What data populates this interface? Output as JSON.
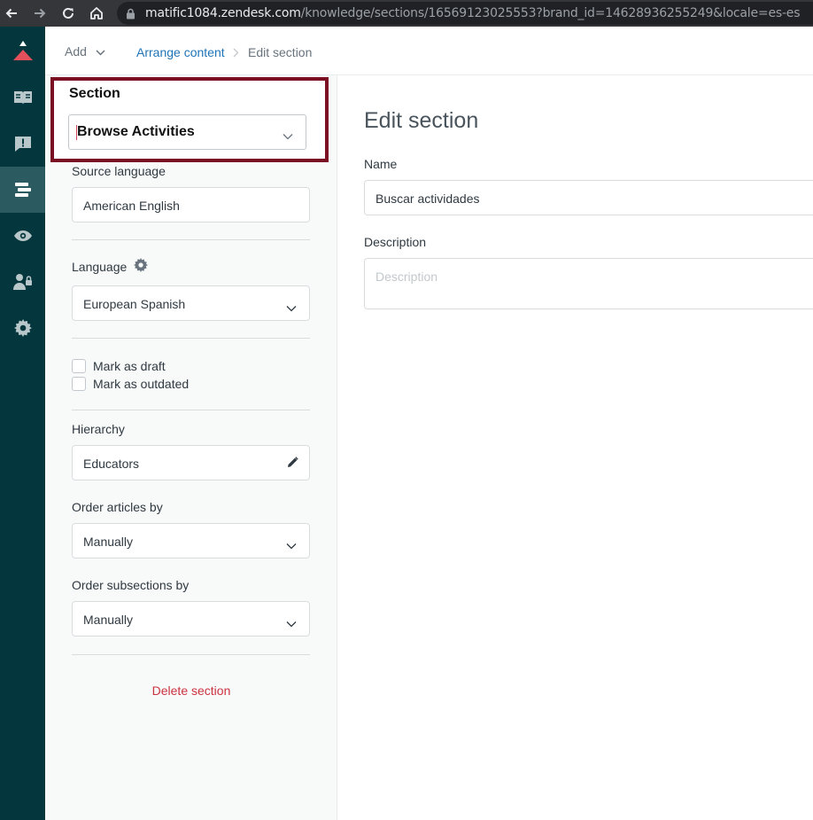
{
  "browser": {
    "url_host": "matific1084.zendesk.com",
    "url_path": "/knowledge/sections/16569123025553?brand_id=14628936255249&locale=es-es",
    "icons": [
      "back-arrow-icon",
      "forward-arrow-icon",
      "reload-icon",
      "home-icon",
      "lock-icon"
    ]
  },
  "rail": {
    "items": [
      {
        "name": "zendesk-logo-icon"
      },
      {
        "name": "knowledge-book-icon"
      },
      {
        "name": "alert-message-icon"
      },
      {
        "name": "arrange-content-icon",
        "active": true
      },
      {
        "name": "eye-icon"
      },
      {
        "name": "user-lock-icon"
      },
      {
        "name": "gear-icon"
      }
    ]
  },
  "topbar": {
    "add_label": "Add",
    "breadcrumb_link": "Arrange content",
    "breadcrumb_current": "Edit section"
  },
  "sidebar": {
    "section_label": "Section",
    "section_value": "Browse Activities",
    "source_language_label": "Source language",
    "source_language_value": "American English",
    "language_label": "Language",
    "language_value": "European Spanish",
    "mark_draft_label": "Mark as draft",
    "mark_outdated_label": "Mark as outdated",
    "hierarchy_label": "Hierarchy",
    "hierarchy_value": "Educators",
    "order_articles_label": "Order articles by",
    "order_articles_value": "Manually",
    "order_subsections_label": "Order subsections by",
    "order_subsections_value": "Manually",
    "delete_label": "Delete section"
  },
  "main": {
    "title": "Edit section",
    "name_label": "Name",
    "name_value": "Buscar actividades",
    "description_label": "Description",
    "description_placeholder": "Description"
  },
  "colors": {
    "rail_bg": "#03363d",
    "rail_active": "#2b5a60",
    "highlight_border": "#7a0f23",
    "link_blue": "#1f73b7",
    "danger_red": "#cc3340"
  }
}
